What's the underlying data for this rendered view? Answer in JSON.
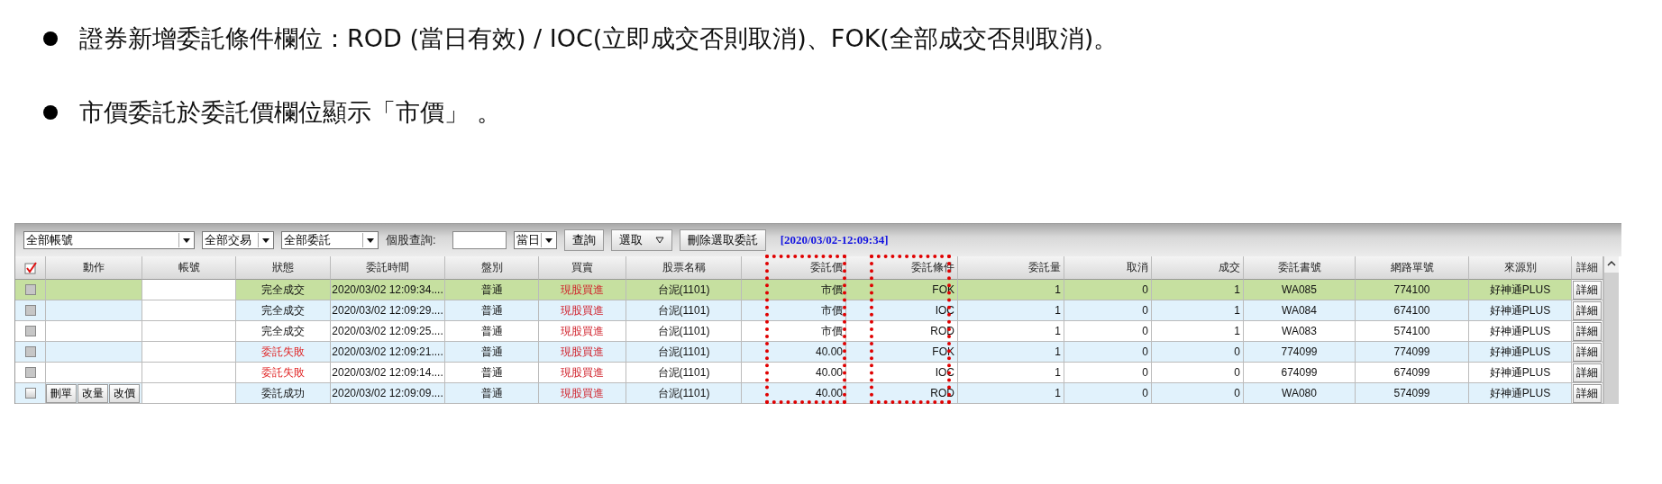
{
  "bullets": [
    "證券新增委託條件欄位：ROD (當日有效)  / IOC(立即成交否則取消)、FOK(全部成交否則取消)。",
    "市價委託於委託價欄位顯示「市價」 。"
  ],
  "toolbar": {
    "account_filter": "全部帳號",
    "trade_filter": "全部交易",
    "order_filter": "全部委託",
    "stock_query_label": "個股查詢:",
    "period": "當日",
    "query_button": "查詢",
    "select_button": "選取",
    "delete_button": "刪除選取委託",
    "timestamp": "[2020/03/02-12:09:34]"
  },
  "table": {
    "select_all_checked": true,
    "columns": [
      {
        "label": "動作",
        "highlighted": false
      },
      {
        "label": "帳號",
        "highlighted": false
      },
      {
        "label": "狀態",
        "highlighted": false
      },
      {
        "label": "委託時間",
        "highlighted": false
      },
      {
        "label": "盤別",
        "highlighted": false
      },
      {
        "label": "買賣",
        "highlighted": false
      },
      {
        "label": "股票名稱",
        "highlighted": false
      },
      {
        "label": "委託價",
        "highlighted": true
      },
      {
        "label": "委託條件",
        "highlighted": true
      },
      {
        "label": "委託量",
        "highlighted": false
      },
      {
        "label": "取消",
        "highlighted": false
      },
      {
        "label": "成交",
        "highlighted": false
      },
      {
        "label": "委託書號",
        "highlighted": false
      },
      {
        "label": "網路單號",
        "highlighted": false
      },
      {
        "label": "來源別",
        "highlighted": false
      },
      {
        "label": "詳細",
        "highlighted": false
      }
    ],
    "rows": [
      {
        "selected": true,
        "checkbox_enabled": false,
        "status": "完全成交",
        "failed": false,
        "time": "2020/03/02 12:09:34....",
        "session": "普通",
        "side": "現股買進",
        "stock": "台泥(1101)",
        "price": "市價",
        "condition": "FOK",
        "quantity": "1",
        "cancelled": "0",
        "filled": "1",
        "order_no": "WA085",
        "web_order_no": "774100",
        "source": "好神通PLUS",
        "detail": "詳細"
      },
      {
        "selected": false,
        "checkbox_enabled": false,
        "status": "完全成交",
        "failed": false,
        "time": "2020/03/02 12:09:29....",
        "session": "普通",
        "side": "現股買進",
        "stock": "台泥(1101)",
        "price": "市價",
        "condition": "IOC",
        "quantity": "1",
        "cancelled": "0",
        "filled": "1",
        "order_no": "WA084",
        "web_order_no": "674100",
        "source": "好神通PLUS",
        "detail": "詳細"
      },
      {
        "selected": false,
        "checkbox_enabled": false,
        "status": "完全成交",
        "failed": false,
        "time": "2020/03/02 12:09:25....",
        "session": "普通",
        "side": "現股買進",
        "stock": "台泥(1101)",
        "price": "市價",
        "condition": "ROD",
        "quantity": "1",
        "cancelled": "0",
        "filled": "1",
        "order_no": "WA083",
        "web_order_no": "574100",
        "source": "好神通PLUS",
        "detail": "詳細"
      },
      {
        "selected": false,
        "checkbox_enabled": false,
        "status": "委託失敗",
        "failed": true,
        "time": "2020/03/02 12:09:21....",
        "session": "普通",
        "side": "現股買進",
        "stock": "台泥(1101)",
        "price": "40.00",
        "condition": "FOK",
        "quantity": "1",
        "cancelled": "0",
        "filled": "0",
        "order_no": "774099",
        "web_order_no": "774099",
        "source": "好神通PLUS",
        "detail": "詳細"
      },
      {
        "selected": false,
        "checkbox_enabled": false,
        "status": "委託失敗",
        "failed": true,
        "time": "2020/03/02 12:09:14....",
        "session": "普通",
        "side": "現股買進",
        "stock": "台泥(1101)",
        "price": "40.00",
        "condition": "IOC",
        "quantity": "1",
        "cancelled": "0",
        "filled": "0",
        "order_no": "674099",
        "web_order_no": "674099",
        "source": "好神通PLUS",
        "detail": "詳細"
      },
      {
        "selected": false,
        "checkbox_enabled": true,
        "actions": [
          "刪單",
          "改量",
          "改價"
        ],
        "status": "委託成功",
        "failed": false,
        "time": "2020/03/02 12:09:09....",
        "session": "普通",
        "side": "現股買進",
        "stock": "台泥(1101)",
        "price": "40.00",
        "condition": "ROD",
        "quantity": "1",
        "cancelled": "0",
        "filled": "0",
        "order_no": "WA080",
        "web_order_no": "574099",
        "source": "好神通PLUS",
        "detail": "詳細"
      }
    ]
  }
}
